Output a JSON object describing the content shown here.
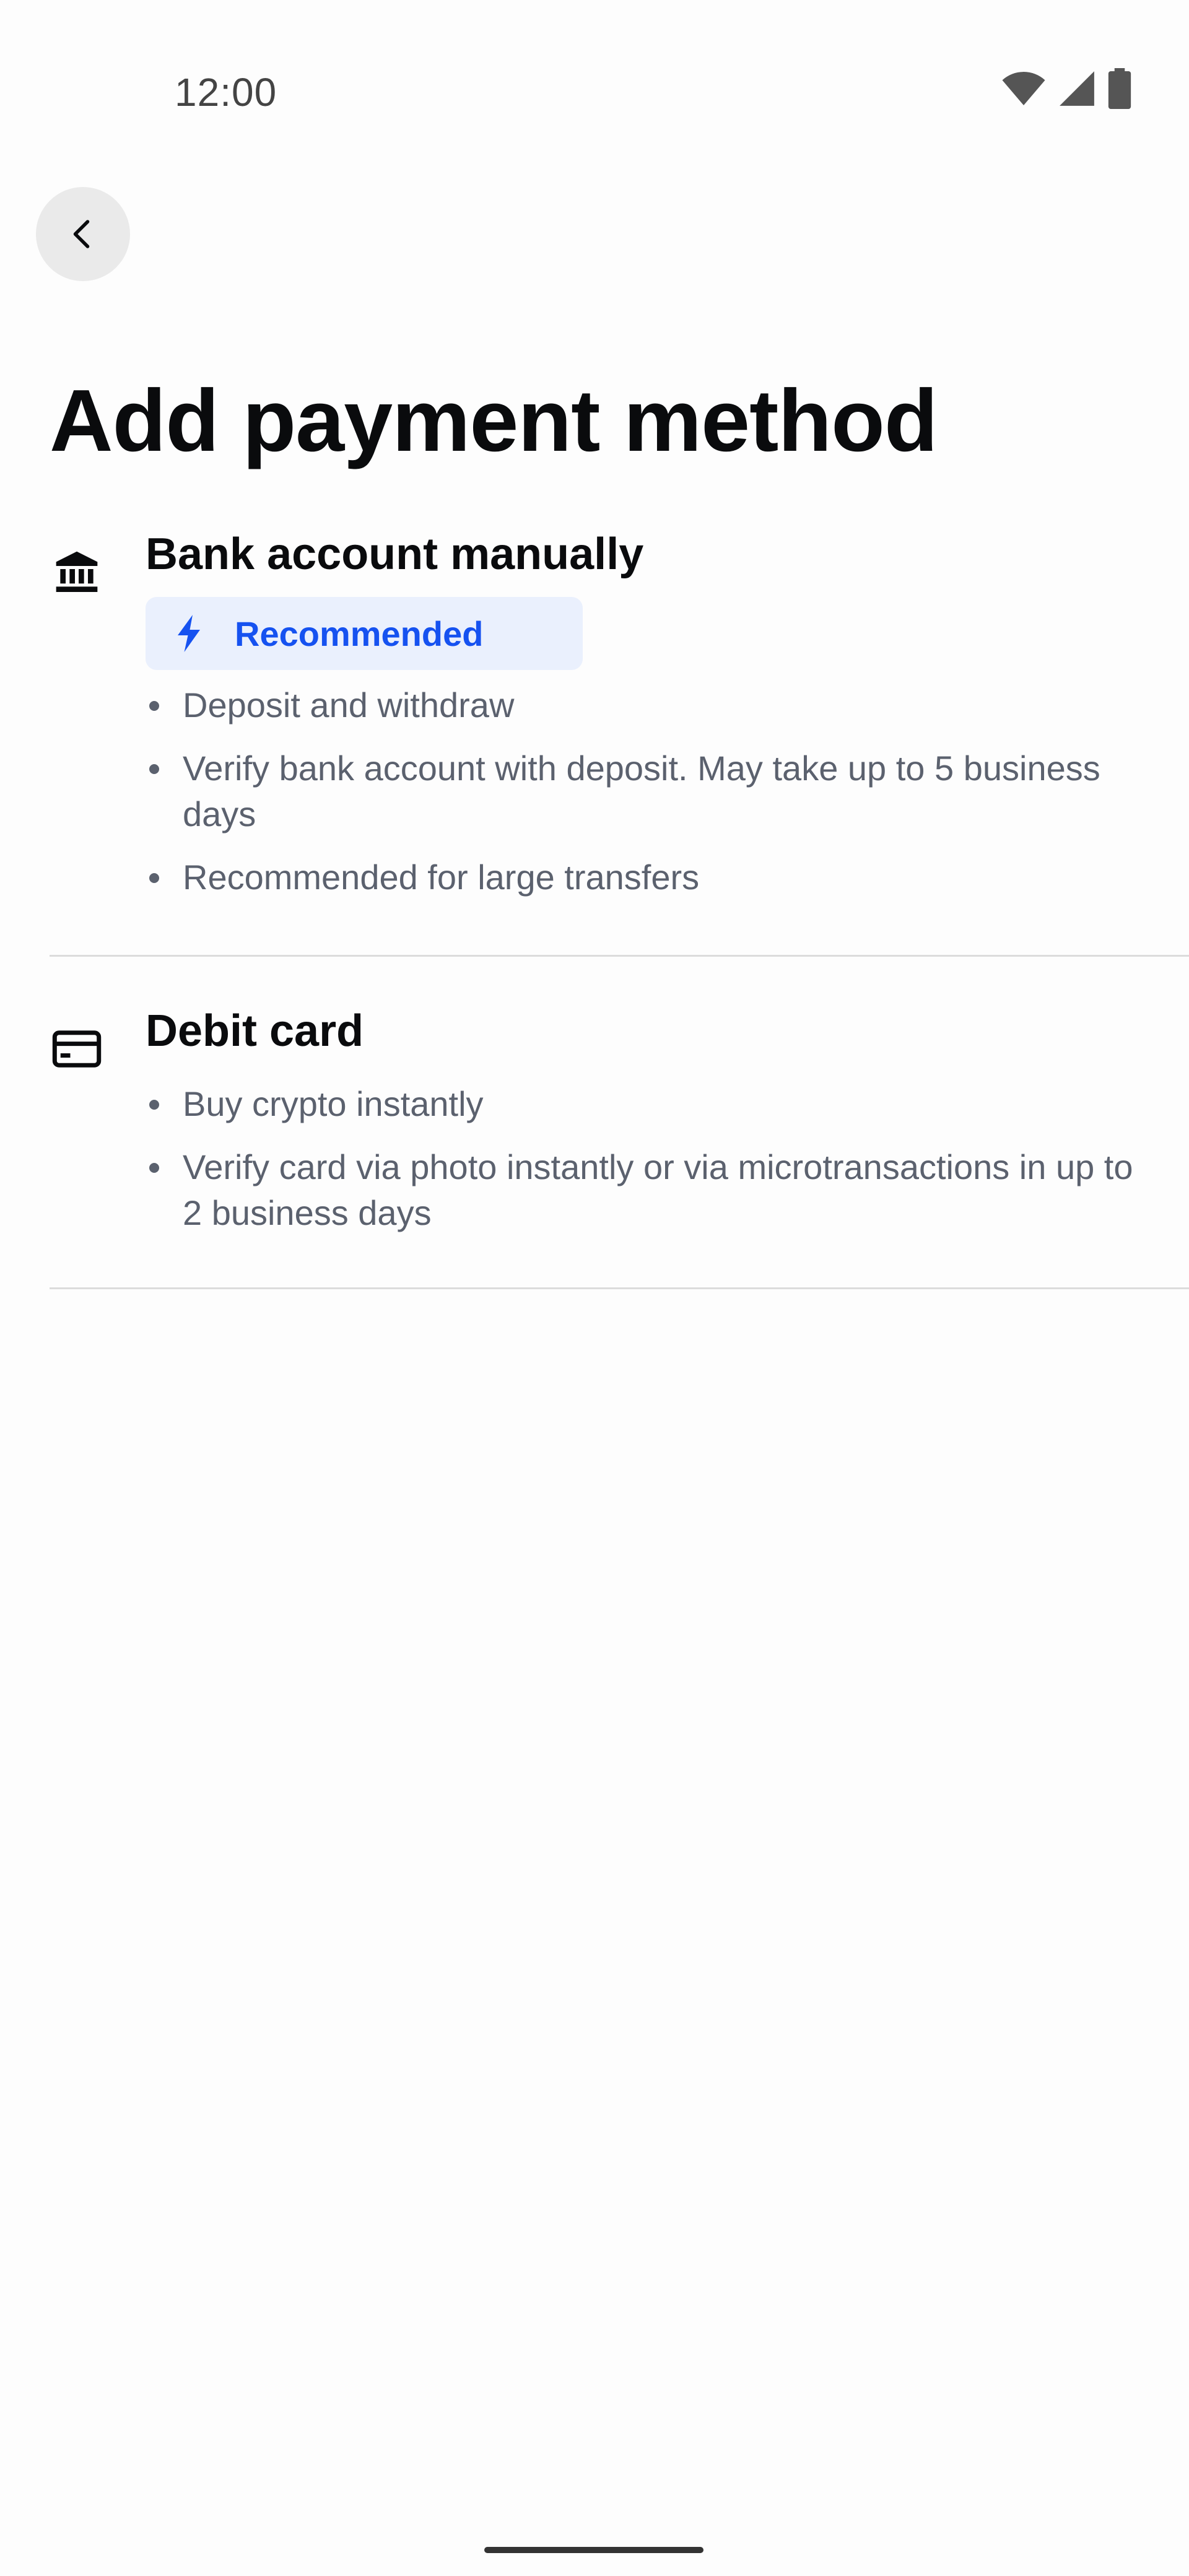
{
  "status_bar": {
    "time": "12:00",
    "icons": [
      "wifi-icon",
      "cell-signal-icon",
      "battery-icon"
    ]
  },
  "nav": {
    "back_icon": "chevron-left-icon"
  },
  "page": {
    "title": "Add payment method"
  },
  "options": [
    {
      "icon": "bank-icon",
      "title": "Bank account manually",
      "badge": {
        "icon": "lightning-icon",
        "label": "Recommended"
      },
      "bullets": [
        "Deposit and withdraw",
        "Verify bank account with deposit. May take up to 5 business days",
        "Recommended for large transfers"
      ]
    },
    {
      "icon": "credit-card-icon",
      "title": "Debit card",
      "bullets": [
        "Buy crypto instantly",
        "Verify card via photo instantly or via microtransactions in up to 2 business days"
      ]
    }
  ],
  "colors": {
    "accent": "#1652f0",
    "badge_bg": "#eaf0fd",
    "text_primary": "#0a0b0d",
    "text_secondary": "#5b616e",
    "divider": "#dcdcdc"
  }
}
